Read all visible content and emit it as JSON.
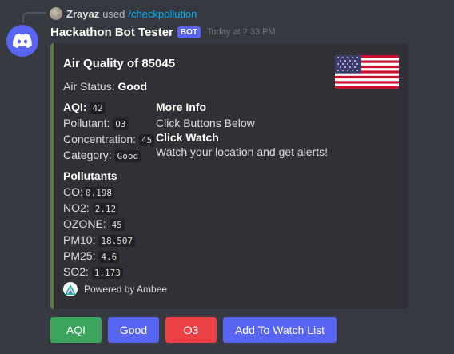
{
  "reply": {
    "user": "Zrayaz",
    "used_text": "used",
    "command": "/checkpollution"
  },
  "message": {
    "author": "Hackathon Bot Tester",
    "bot_tag": "BOT",
    "timestamp": "Today at 2:33 PM"
  },
  "embed": {
    "accent_color": "#5a7a3f",
    "title": "Air Quality of 85045",
    "air_status_label": "Air Status:",
    "air_status_value": "Good",
    "aqi_label": "AQI:",
    "aqi_value": "42",
    "pollutant_label": "Pollutant:",
    "pollutant_value": "O3",
    "concentration_label": "Concentration:",
    "concentration_value": "45",
    "category_label": "Category:",
    "category_value": "Good",
    "more_info_title": "More Info",
    "more_info_text": "Click Buttons Below",
    "click_watch_title": "Click Watch",
    "click_watch_text": "Watch your location and get alerts!",
    "pollutants_title": "Pollutants",
    "pollutants": [
      {
        "label": "CO:",
        "value": "0.198"
      },
      {
        "label": "NO2:",
        "value": "2.12"
      },
      {
        "label": "OZONE:",
        "value": "45"
      },
      {
        "label": "PM10:",
        "value": "18.507"
      },
      {
        "label": "PM25:",
        "value": "4.6"
      },
      {
        "label": "SO2:",
        "value": "1.173"
      }
    ],
    "footer_text": "Powered by Ambee",
    "thumbnail_icon": "us-flag-icon"
  },
  "buttons": [
    {
      "label": "AQI",
      "color": "#3ba55d"
    },
    {
      "label": "Good",
      "color": "#5865f2"
    },
    {
      "label": "O3",
      "color": "#ed4245"
    },
    {
      "label": "Add To Watch List",
      "color": "#5865f2"
    }
  ]
}
